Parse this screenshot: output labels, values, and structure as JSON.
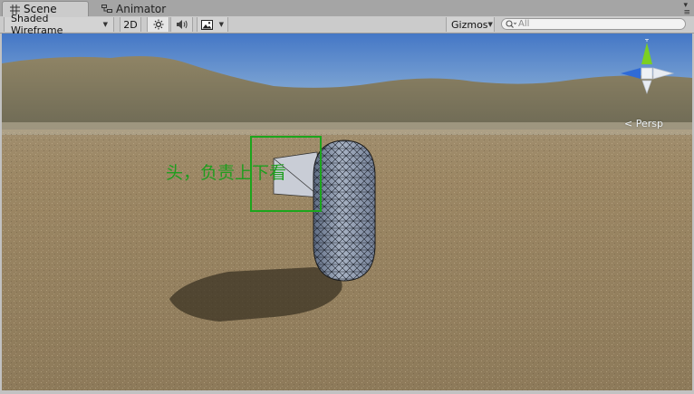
{
  "tabs": [
    {
      "label": "Scene",
      "icon": "grid-icon",
      "active": true
    },
    {
      "label": "Animator",
      "icon": "animator-icon",
      "active": false
    }
  ],
  "toolbar": {
    "draw_mode": "Shaded Wireframe",
    "mode_2d": "2D",
    "lighting_icon": "sun-icon",
    "audio_icon": "speaker-icon",
    "effects_icon": "image-icon",
    "gizmos": "Gizmos",
    "search_placeholder": "All"
  },
  "scene": {
    "annotation": "头，负责上下看",
    "projection": "Persp"
  },
  "colors": {
    "annotation": "#1ca51c",
    "gizmo_y": "#7ccf22",
    "gizmo_x": "#2f6bd8"
  }
}
